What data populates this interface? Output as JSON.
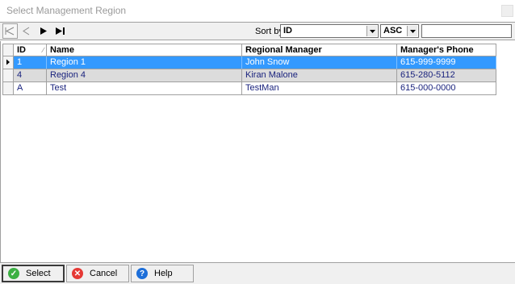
{
  "window": {
    "title": "Select Management Region"
  },
  "toolbar": {
    "sort_label": "Sort by",
    "sort_field": "ID",
    "sort_order": "ASC",
    "filter_value": ""
  },
  "grid": {
    "columns": [
      "ID",
      "Name",
      "Regional Manager",
      "Manager's Phone"
    ],
    "rows": [
      {
        "id": "1",
        "name": "Region 1",
        "manager": "John Snow",
        "phone": "615-999-9999"
      },
      {
        "id": "4",
        "name": "Region 4",
        "manager": "Kiran Malone",
        "phone": "615-280-5112"
      },
      {
        "id": "A",
        "name": "Test",
        "manager": "TestMan",
        "phone": "615-000-0000"
      }
    ],
    "selected_index": 0
  },
  "footer": {
    "select_label": "Select",
    "cancel_label": "Cancel",
    "help_label": "Help"
  },
  "colors": {
    "selection": "#3399ff",
    "alt_row": "#dcdcdc",
    "cell_text": "#1a237e",
    "select_icon": "#3cb043",
    "cancel_icon": "#e53935",
    "help_icon": "#1e6fd9"
  }
}
